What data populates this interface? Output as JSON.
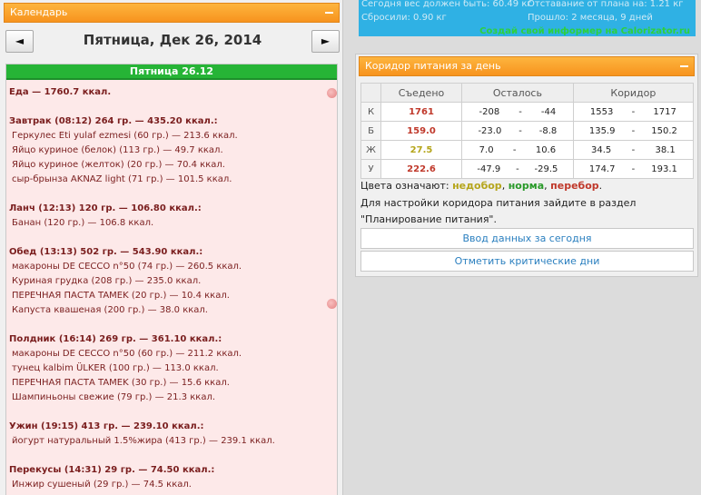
{
  "calendar": {
    "header_title": "Календарь",
    "nav_prev": "◄",
    "nav_next": "►",
    "date_title": "Пятница, Дек 26, 2014",
    "day_label": "Пятница 26.12",
    "lines": [
      {
        "text": "Еда — 1760.7 ккал.",
        "kind": "bold"
      },
      {
        "text": "",
        "kind": "gap"
      },
      {
        "text": "Завтрак (08:12) 264 гр. — 435.20 ккал.:",
        "kind": "bold"
      },
      {
        "text": "Геркулес Eti yulaf ezmesi (60 гр.) — 213.6 ккал.",
        "kind": "item"
      },
      {
        "text": "Яйцо куриное (белок) (113 гр.) — 49.7 ккал.",
        "kind": "item"
      },
      {
        "text": "Яйцо куриное (желток) (20 гр.) — 70.4 ккал.",
        "kind": "item"
      },
      {
        "text": "сыр-брынза AKNAZ light (71 гр.) — 101.5 ккал.",
        "kind": "item"
      },
      {
        "text": "",
        "kind": "gap"
      },
      {
        "text": "Ланч (12:13) 120 гр. — 106.80 ккал.:",
        "kind": "bold"
      },
      {
        "text": "Банан (120 гр.) — 106.8 ккал.",
        "kind": "item"
      },
      {
        "text": "",
        "kind": "gap"
      },
      {
        "text": "Обед (13:13) 502 гр. — 543.90 ккал.:",
        "kind": "bold"
      },
      {
        "text": "макароны DE CECCO n°50 (74 гр.) — 260.5 ккал.",
        "kind": "item"
      },
      {
        "text": "Куриная грудка (208 гр.) — 235.0 ккал.",
        "kind": "item"
      },
      {
        "text": "ПЕРЕЧНАЯ ПАСТА TAMEK (20 гр.) — 10.4 ккал.",
        "kind": "item"
      },
      {
        "text": "Капуста квашеная (200 гр.) — 38.0 ккал.",
        "kind": "item"
      },
      {
        "text": "",
        "kind": "gap"
      },
      {
        "text": "Полдник (16:14) 269 гр. — 361.10 ккал.:",
        "kind": "bold"
      },
      {
        "text": "макароны DE CECCO n°50 (60 гр.) — 211.2 ккал.",
        "kind": "item"
      },
      {
        "text": "тунец kalbim ÜLKER (100 гр.) — 113.0 ккал.",
        "kind": "item"
      },
      {
        "text": "ПЕРЕЧНАЯ ПАСТА TAMEK (30 гр.) — 15.6 ккал.",
        "kind": "item"
      },
      {
        "text": "Шампиньоны свежие (79 гр.) — 21.3 ккал.",
        "kind": "item"
      },
      {
        "text": "",
        "kind": "gap"
      },
      {
        "text": "Ужин (19:15) 413 гр. — 239.10 ккал.:",
        "kind": "bold"
      },
      {
        "text": "йогурт натуральный 1.5%жира (413 гр.) — 239.1 ккал.",
        "kind": "item"
      },
      {
        "text": "",
        "kind": "gap"
      },
      {
        "text": "Перекусы (14:31) 29 гр. — 74.50 ккал.:",
        "kind": "bold"
      },
      {
        "text": "Инжир сушеный (29 гр.) — 74.5 ккал.",
        "kind": "item"
      }
    ]
  },
  "stats": {
    "weight_should": "Сегодня вес должен быть: 60.49 кг",
    "lag": "Отставание от плана на: 1.21 кг",
    "lost": "Сбросили: 0.90 кг",
    "elapsed": "Прошло: 2 месяца, 9 дней",
    "promo_link": "Создай свой информер на Calorizator.ru"
  },
  "corridor": {
    "header_title": "Коридор питания за день",
    "columns": [
      "",
      "Съедено",
      "Осталось",
      "Коридор"
    ],
    "rows": [
      {
        "label": "К",
        "eaten": "1761",
        "color": "#c0392b",
        "rem_from": "-208",
        "rem_to": "-44",
        "cor_from": "1553",
        "cor_to": "1717"
      },
      {
        "label": "Б",
        "eaten": "159.0",
        "color": "#c0392b",
        "rem_from": "-23.0",
        "rem_to": "-8.8",
        "cor_from": "135.9",
        "cor_to": "150.2"
      },
      {
        "label": "Ж",
        "eaten": "27.5",
        "color": "#b5a51b",
        "rem_from": "7.0",
        "rem_to": "10.6",
        "cor_from": "34.5",
        "cor_to": "38.1"
      },
      {
        "label": "У",
        "eaten": "222.6",
        "color": "#c0392b",
        "rem_from": "-47.9",
        "rem_to": "-29.5",
        "cor_from": "174.7",
        "cor_to": "193.1"
      }
    ],
    "dash": "-",
    "legend_prefix": "Цвета означают: ",
    "legend_under": "недобор",
    "legend_normal": "норма",
    "legend_over": "перебор",
    "legend_sep": ", ",
    "legend_end": ".",
    "colors": {
      "under": "#b5a51b",
      "normal": "#2a9a2a",
      "over": "#c0392b"
    },
    "desc_line1": "Для настройки коридора питания зайдите в раздел",
    "desc_line2": "\"Планирование питания\".",
    "btn_enter": "Ввод данных за сегодня",
    "btn_critical": "Отметить критические дни"
  }
}
